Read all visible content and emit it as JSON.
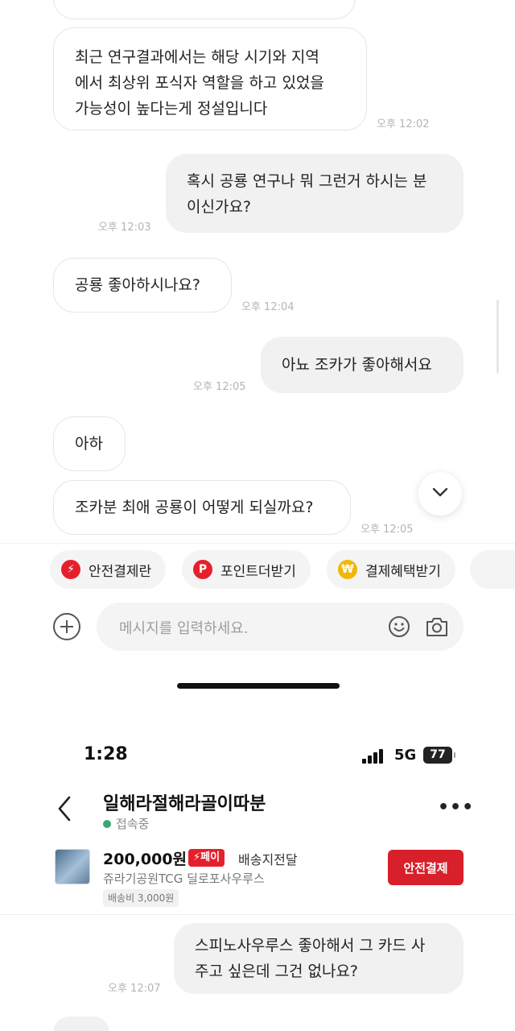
{
  "chat_top": {
    "messages": [
      {
        "dir": "in",
        "lines": [
          "최근 연구결과에서는 해당 시기와 지역",
          "에서 최상위 포식자 역할을 하고 있었을",
          "가능성이 높다는게 정설입니다"
        ],
        "time": "오후 12:02"
      },
      {
        "dir": "out",
        "lines": [
          "혹시 공룡 연구나 뭐 그런거 하시는 분",
          "이신가요?"
        ],
        "time": "오후 12:03"
      },
      {
        "dir": "in",
        "lines": [
          "공룡 좋아하시나요?"
        ],
        "time": "오후 12:04"
      },
      {
        "dir": "out",
        "lines": [
          "아뇨 조카가 좋아해서요"
        ],
        "time": "오후 12:05"
      },
      {
        "dir": "in",
        "lines": [
          "아하"
        ],
        "time": ""
      },
      {
        "dir": "in",
        "lines": [
          "조카분 최애 공룡이 어떻게 되실까요?"
        ],
        "time": "오후 12:05"
      }
    ]
  },
  "quick_actions": [
    {
      "label": "안전결제란",
      "icon": "lightning-icon",
      "color": "#e5202c"
    },
    {
      "label": "포인트더받기",
      "icon": "point-p-icon",
      "color": "#e5202c"
    },
    {
      "label": "결제혜택받기",
      "icon": "won-coin-icon",
      "color": "#f2b705"
    }
  ],
  "composer": {
    "placeholder": "메시지를 입력하세요."
  },
  "status_bar": {
    "time": "1:28",
    "network": "5G",
    "battery": "77"
  },
  "header": {
    "partner_name": "일해라절해라골이따분",
    "presence": "접속중"
  },
  "product": {
    "price": "200,000원",
    "pay_badge": "⚡페이",
    "delivery": "배송지전달",
    "title": "쥬라기공원TCG 딜로포사우루스",
    "shipping_fee": "배송비 3,000원",
    "safe_pay_button": "안전결제"
  },
  "chat_bottom": {
    "messages": [
      {
        "dir": "out",
        "lines": [
          "스피노사우루스 좋아해서 그 카드 사",
          "주고 싶은데 그건 없나요?"
        ],
        "time": "오후 12:07"
      }
    ]
  }
}
